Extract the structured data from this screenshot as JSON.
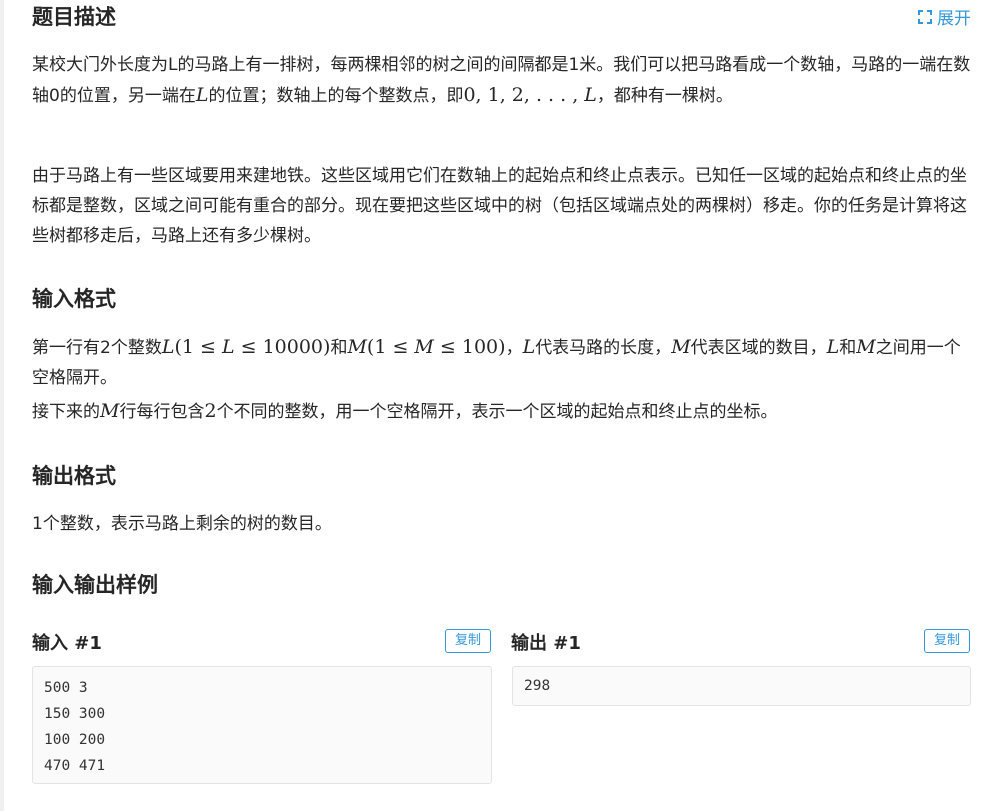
{
  "description": {
    "title": "题目描述",
    "expand_label": "展开",
    "p1": {
      "a": "某校大门外长度为L的马路上有一排树，每两棵相邻的树之间的间隔都是1米。我们可以把马路看成一个数轴，马路的一端在数轴0的位置，另一端在",
      "m1": "L",
      "b": "的位置；数轴上的每个整数点，即",
      "m2": "0, 1, 2, . . . , ",
      "m3": "L",
      "c": "，都种有一棵树。"
    },
    "p2": "由于马路上有一些区域要用来建地铁。这些区域用它们在数轴上的起始点和终止点表示。已知任一区域的起始点和终止点的坐标都是整数，区域之间可能有重合的部分。现在要把这些区域中的树（包括区域端点处的两棵树）移走。你的任务是计算将这些树都移走后，马路上还有多少棵树。"
  },
  "input_format": {
    "title": "输入格式",
    "line1": {
      "a": "第一行有2个整数",
      "m1": "L",
      "m1b": "(1 ≤ ",
      "m1c": "L",
      "m1d": " ≤ 10000)",
      "b": "和",
      "m2": "M",
      "m2b": "(1 ≤ ",
      "m2c": "M",
      "m2d": " ≤ 100)",
      "c": "，",
      "m3": "L",
      "d": "代表马路的长度，",
      "m4": "M",
      "e": "代表区域的数目，",
      "m5": "L",
      "f": "和",
      "m6": "M",
      "g": "之间用一个空格隔开。"
    },
    "line2": {
      "a": "接下来的",
      "m1": "M",
      "b": "行每行包含",
      "m2": "2",
      "c": "个不同的整数，用一个空格隔开，表示一个区域的起始点和终止点的坐标。"
    }
  },
  "output_format": {
    "title": "输出格式",
    "text": "1个整数，表示马路上剩余的树的数目。"
  },
  "samples": {
    "title": "输入输出样例",
    "input_title": "输入 #1",
    "output_title": "输出 #1",
    "copy_label": "复制",
    "input_lines": [
      "500 3",
      "150 300",
      "100 200",
      "470 471"
    ],
    "output_lines": [
      "298"
    ]
  },
  "colors": {
    "accent": "#3498db",
    "text": "#262626",
    "code_bg": "#fafafa",
    "code_border": "#e3e3e3"
  },
  "icons": {
    "expand": "expand-icon"
  }
}
